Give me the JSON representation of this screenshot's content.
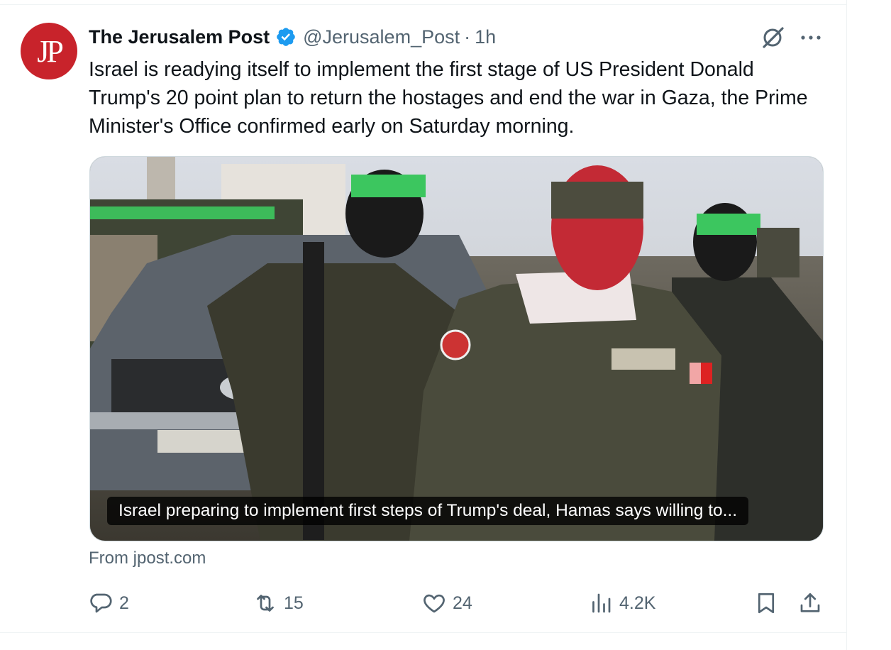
{
  "tweet": {
    "author_name": "The Jerusalem Post",
    "avatar_text": "JP",
    "handle": "@Jerusalem_Post",
    "separator": "·",
    "time": "1h",
    "text": "Israel is readying itself to implement the first stage of US President Donald Trump's 20 point plan to return the hostages and end the war in Gaza, the Prime Minister's Office confirmed early on Saturday morning.",
    "verified_icon": "verified-badge-icon",
    "accent_color": "#1d9bf0",
    "brand_color": "#c8232b"
  },
  "card": {
    "caption": "Israel preparing to implement first steps of Trump's deal, Hamas says willing to...",
    "source": "From jpost.com",
    "image_icon": "news-photo"
  },
  "actions": {
    "reply_count": "2",
    "retweet_count": "15",
    "like_count": "24",
    "view_count": "4.2K"
  }
}
